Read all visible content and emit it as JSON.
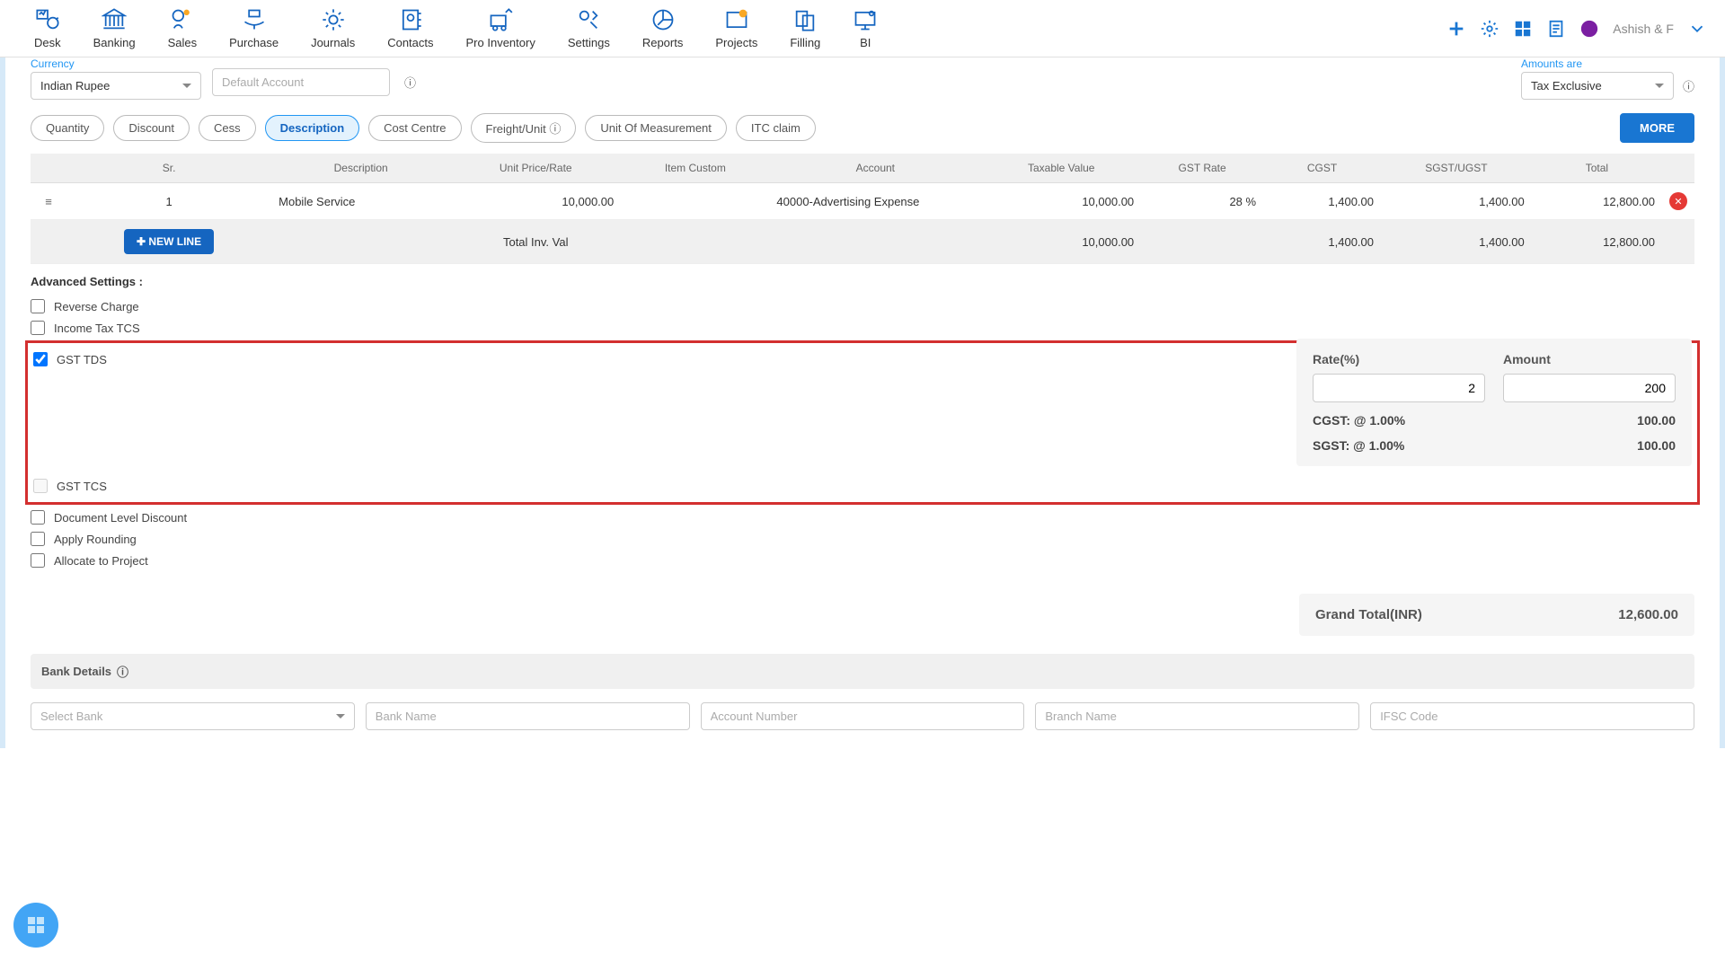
{
  "nav": {
    "items": [
      "Desk",
      "Banking",
      "Sales",
      "Purchase",
      "Journals",
      "Contacts",
      "Pro Inventory",
      "Settings",
      "Reports",
      "Projects",
      "Filling",
      "BI"
    ],
    "user": "Ashish & F"
  },
  "currency": {
    "label": "Currency",
    "value": "Indian Rupee"
  },
  "default_account": {
    "placeholder": "Default Account"
  },
  "amounts_are": {
    "label": "Amounts are",
    "value": "Tax Exclusive"
  },
  "pills": [
    "Quantity",
    "Discount",
    "Cess",
    "Description",
    "Cost Centre",
    "Freight/Unit",
    "Unit Of Measurement",
    "ITC claim"
  ],
  "pill_more": "MORE",
  "table": {
    "headers": [
      "Sr.",
      "Description",
      "Unit Price/Rate",
      "Item Custom",
      "Account",
      "Taxable Value",
      "GST Rate",
      "CGST",
      "SGST/UGST",
      "Total"
    ],
    "row": {
      "sr": "1",
      "desc": "Mobile Service",
      "unit_price": "10,000.00",
      "item_custom": "",
      "account": "40000-Advertising Expense",
      "taxable": "10,000.00",
      "gst_rate": "28 %",
      "cgst": "1,400.00",
      "sgst": "1,400.00",
      "total": "12,800.00"
    },
    "new_line": "NEW LINE",
    "total_label": "Total Inv. Val",
    "totals": {
      "taxable": "10,000.00",
      "cgst": "1,400.00",
      "sgst": "1,400.00",
      "total": "12,800.00"
    }
  },
  "adv": {
    "title": "Advanced Settings :",
    "reverse": "Reverse Charge",
    "income_tcs": "Income Tax TCS",
    "gst_tds": "GST TDS",
    "gst_tcs": "GST TCS",
    "doc_disc": "Document Level Discount",
    "rounding": "Apply Rounding",
    "allocate": "Allocate to Project"
  },
  "tds_panel": {
    "rate_label": "Rate(%)",
    "amount_label": "Amount",
    "rate": "2",
    "amount": "200",
    "cgst_lbl": "CGST: @ 1.00%",
    "cgst_val": "100.00",
    "sgst_lbl": "SGST: @ 1.00%",
    "sgst_val": "100.00"
  },
  "grand": {
    "label": "Grand Total(INR)",
    "value": "12,600.00"
  },
  "bank": {
    "title": "Bank Details",
    "select": "Select Bank",
    "name_ph": "Bank Name",
    "acct_ph": "Account Number",
    "branch_ph": "Branch Name",
    "ifsc_ph": "IFSC Code"
  }
}
